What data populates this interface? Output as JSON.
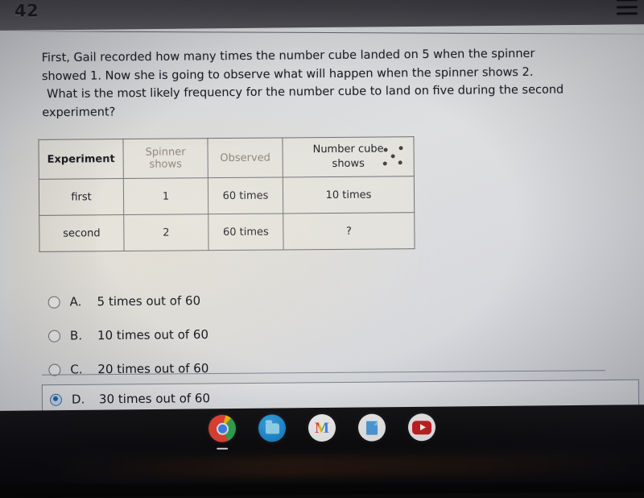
{
  "header": {
    "page_number": "42",
    "menu_icon": "hamburger-icon"
  },
  "question": {
    "line1": "First, Gail recorded how many times the number cube landed on 5 when the spinner",
    "line2": "showed 1.  Now she is going to observe what will happen when the spinner shows 2.",
    "line3": "What is the most likely frequency for the number cube to land on five during the second",
    "line4": "experiment?"
  },
  "table": {
    "headers": {
      "experiment": "Experiment",
      "spinner": "Spinner shows",
      "spinner_line1": "Spinner",
      "spinner_line2": "shows",
      "observed": "Observed",
      "cube_line1": "Number cube",
      "cube_line2": "shows",
      "cube_die_icon": "die-five-icon"
    },
    "rows": [
      {
        "experiment": "first",
        "spinner": "1",
        "observed": "60 times",
        "cube": "10 times"
      },
      {
        "experiment": "second",
        "spinner": "2",
        "observed": "60 times",
        "cube": "?"
      }
    ]
  },
  "options": [
    {
      "letter": "A.",
      "text": "5 times out of 60",
      "selected": false
    },
    {
      "letter": "B.",
      "text": "10 times out of 60",
      "selected": false
    },
    {
      "letter": "C.",
      "text": "20 times out of 60",
      "selected": false
    },
    {
      "letter": "D.",
      "text": "30 times out of 60",
      "selected": true
    }
  ],
  "taskbar": {
    "icons": [
      {
        "name": "chrome-icon",
        "label": "Chrome",
        "active": true
      },
      {
        "name": "files-icon",
        "label": "Files",
        "active": false
      },
      {
        "name": "gmail-icon",
        "label": "Gmail",
        "glyph": "M",
        "active": false
      },
      {
        "name": "docs-icon",
        "label": "Docs",
        "active": false
      },
      {
        "name": "youtube-icon",
        "label": "YouTube",
        "active": false
      }
    ]
  },
  "colors": {
    "accent_blue": "#1f64ad",
    "page_background": "#d6d7d9",
    "text": "#1b1b23",
    "faded_text": "#8b8175",
    "taskbar": "#0b0b0d"
  }
}
